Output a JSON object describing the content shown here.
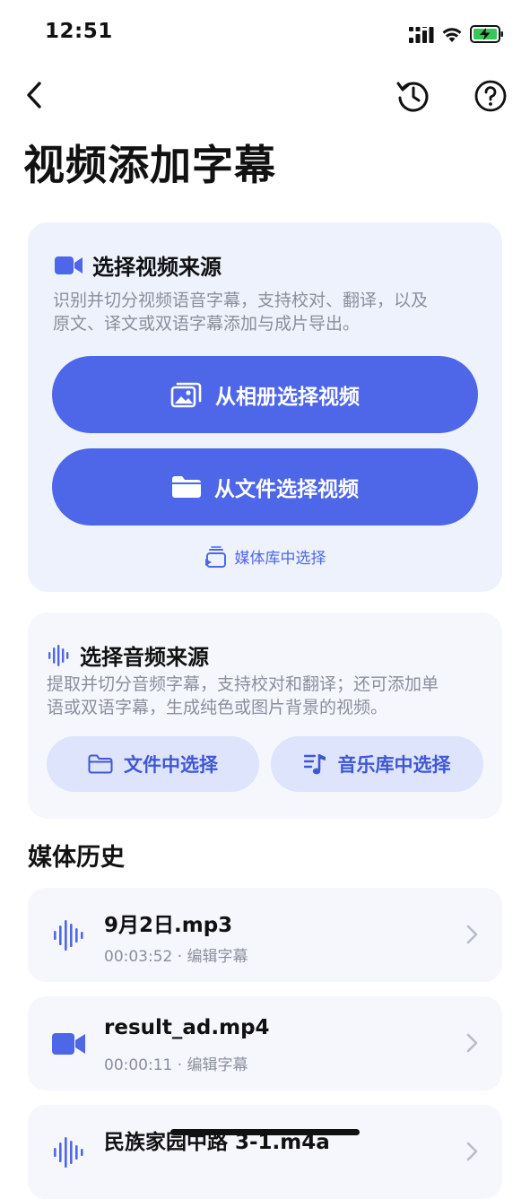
{
  "status_bar": {
    "time": "12:51"
  },
  "nav": {
    "back_icon": "chevron-left-icon",
    "history_icon": "history-clock-icon",
    "help_icon": "question-circle-icon"
  },
  "page_title": "视频添加字幕",
  "video_source": {
    "title": "选择视频来源",
    "description_line1": "识别并切分视频语音字幕，支持校对、翻译，以及",
    "description_line2": "原文、译文或双语字幕添加与成片导出。",
    "album_button": "从相册选择视频",
    "file_button": "从文件选择视频",
    "media_library_link": "媒体库中选择"
  },
  "audio_source": {
    "title": "选择音频来源",
    "description_line1": "提取并切分音频字幕，支持校对和翻译；还可添加单",
    "description_line2": "语或双语字幕，生成纯色或图片背景的视频。",
    "file_button": "文件中选择",
    "music_library_button": "音乐库中选择"
  },
  "media_history": {
    "title": "媒体历史",
    "items": [
      {
        "type": "audio",
        "name": "9月2日.mp3",
        "meta": "00:03:52 · 编辑字幕"
      },
      {
        "type": "video",
        "name": "result_ad.mp4",
        "meta": "00:00:11 · 编辑字幕"
      },
      {
        "type": "audio",
        "name": "民族家园中路 3-1.m4a",
        "meta": ""
      }
    ]
  },
  "colors": {
    "accent": "#4e66e8",
    "video_card_bg": "#eef2fd",
    "audio_card_bg": "#f5f7fd",
    "pill_bg": "#dde4fb",
    "battery_green": "#34c759"
  }
}
